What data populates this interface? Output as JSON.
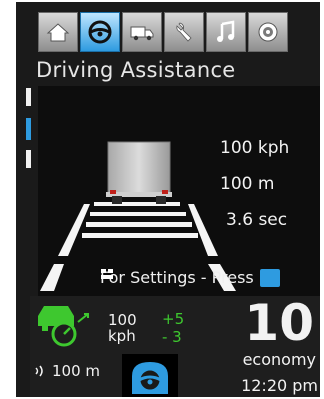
{
  "tabs": [
    {
      "icon": "home-icon",
      "active": false
    },
    {
      "icon": "steering-wheel-icon",
      "active": true
    },
    {
      "icon": "truck-icon",
      "active": false
    },
    {
      "icon": "wrench-icon",
      "active": false
    },
    {
      "icon": "music-note-icon",
      "active": false
    },
    {
      "icon": "settings-gear-icon",
      "active": false
    }
  ],
  "title": "Driving Assistance",
  "scene": {
    "speed": "100 kph",
    "distance": "100 m",
    "time_gap": "3.6 sec",
    "settings_hint": "For Settings - Press"
  },
  "bottom": {
    "set_speed_value": "100",
    "set_speed_unit": "kph",
    "delta_up": "+5",
    "delta_down": "- 3",
    "big_number": "10",
    "mode": "economy",
    "time": "12:20 pm",
    "sensor_distance": "100 m"
  },
  "colors": {
    "accent": "#2e9be0",
    "green": "#3ec82f",
    "text": "#f2f2f2",
    "background": "#1a1a1a"
  }
}
